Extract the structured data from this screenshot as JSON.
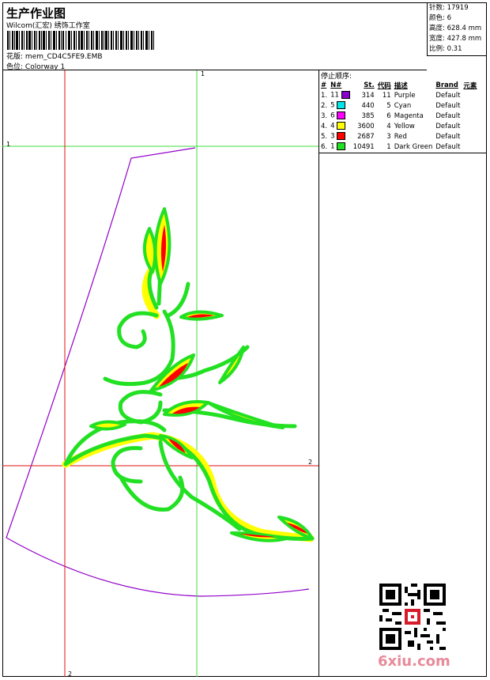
{
  "header": {
    "title": "生产作业图",
    "subtitle": "Wilcom(汇宏) 绣饰工作室",
    "design_label": "花版:",
    "design_value": "mem_CD4C5FE9.EMB",
    "colorway_label": "色位:",
    "colorway_value": "Colorway 1"
  },
  "stats": {
    "stitches": "针数: 17919",
    "colors": "颜色: 6",
    "height": "高度: 628.4 mm",
    "width": "宽度: 427.8 mm",
    "scale": "比例: 0.31"
  },
  "stop_sequence": {
    "title": "停止顺序:",
    "headers": [
      "#",
      "N#",
      "St.",
      "代码",
      "描述",
      "Brand",
      "元素"
    ],
    "rows": [
      {
        "idx": "1.",
        "n": "11",
        "st": "314",
        "code": "11",
        "desc": "Purple",
        "brand": "Default",
        "color": "#8800cc"
      },
      {
        "idx": "2.",
        "n": "5",
        "st": "440",
        "code": "5",
        "desc": "Cyan",
        "brand": "Default",
        "color": "#00e5e5"
      },
      {
        "idx": "3.",
        "n": "6",
        "st": "385",
        "code": "6",
        "desc": "Magenta",
        "brand": "Default",
        "color": "#ff00ff"
      },
      {
        "idx": "4.",
        "n": "4",
        "st": "3600",
        "code": "4",
        "desc": "Yellow",
        "brand": "Default",
        "color": "#ffff00"
      },
      {
        "idx": "5.",
        "n": "3",
        "st": "2687",
        "code": "3",
        "desc": "Red",
        "brand": "Default",
        "color": "#ff0000"
      },
      {
        "idx": "6.",
        "n": "1",
        "st": "10491",
        "code": "1",
        "desc": "Dark Green",
        "brand": "Default",
        "color": "#22e022"
      }
    ]
  },
  "canvas": {
    "axis_labels": {
      "v1": "1",
      "h1": "1",
      "h2": "2",
      "v2": "2"
    }
  },
  "watermark": "6xiu.com"
}
